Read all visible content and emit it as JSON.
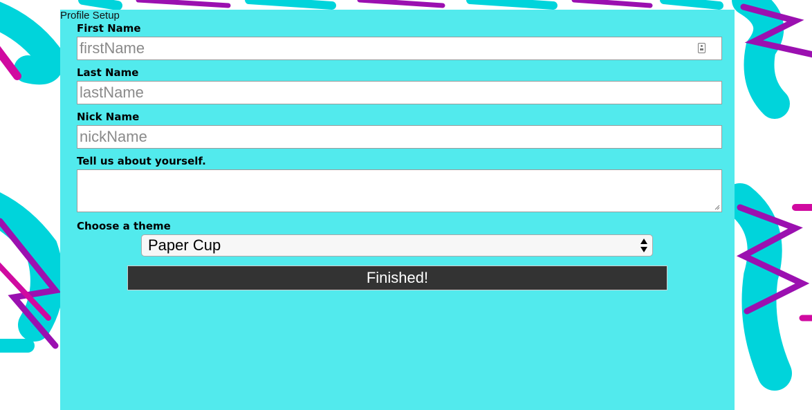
{
  "form": {
    "title": "Profile Setup",
    "first_name": {
      "label": "First Name",
      "placeholder": "firstName",
      "value": ""
    },
    "last_name": {
      "label": "Last Name",
      "placeholder": "lastName",
      "value": ""
    },
    "nick_name": {
      "label": "Nick Name",
      "placeholder": "nickName",
      "value": ""
    },
    "about": {
      "label": "Tell us about yourself.",
      "value": ""
    },
    "theme": {
      "label": "Choose a theme",
      "selected": "Paper Cup"
    },
    "submit_label": "Finished!"
  },
  "colors": {
    "panel": "#52eaed",
    "button": "#333333",
    "accent_teal": "#00d4db",
    "accent_purple": "#9b10b0",
    "accent_magenta": "#d00aa0"
  },
  "icons": {
    "first_name_autofill": "contact-card-icon",
    "theme_select": "up-down-arrows-icon"
  }
}
